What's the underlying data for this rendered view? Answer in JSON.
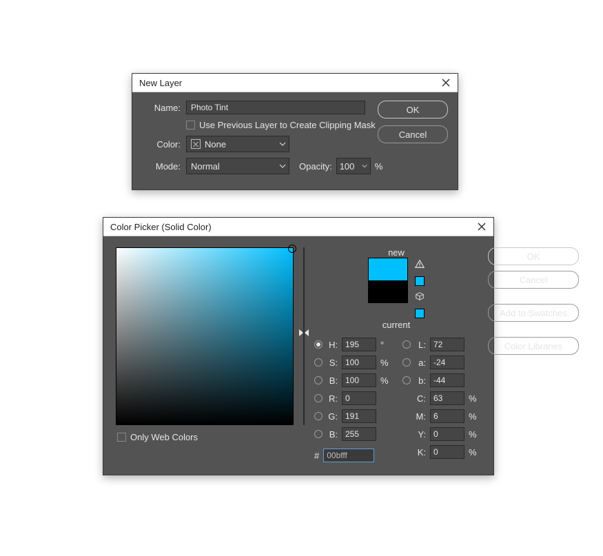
{
  "newLayer": {
    "title": "New Layer",
    "labels": {
      "name": "Name:",
      "color": "Color:",
      "mode": "Mode:",
      "opacity": "Opacity:",
      "pct": "%"
    },
    "nameValue": "Photo Tint",
    "usePrevious": "Use Previous Layer to Create Clipping Mask",
    "colorNone": "None",
    "modeValue": "Normal",
    "opacityValue": "100",
    "buttons": {
      "ok": "OK",
      "cancel": "Cancel"
    }
  },
  "colorPicker": {
    "title": "Color Picker (Solid Color)",
    "labels": {
      "new": "new",
      "current": "current",
      "onlyWeb": "Only Web Colors",
      "hash": "#"
    },
    "buttons": {
      "ok": "OK",
      "cancel": "Cancel",
      "addSwatch": "Add to Swatches",
      "colorLib": "Color Libraries"
    },
    "newColor": "#00bfff",
    "currentColor": "#000000",
    "hex": "00bfff",
    "H": {
      "lbl": "H:",
      "val": "195",
      "unit": "°"
    },
    "S": {
      "lbl": "S:",
      "val": "100",
      "unit": "%"
    },
    "Bhsb": {
      "lbl": "B:",
      "val": "100",
      "unit": "%"
    },
    "R": {
      "lbl": "R:",
      "val": "0"
    },
    "G": {
      "lbl": "G:",
      "val": "191"
    },
    "Brgb": {
      "lbl": "B:",
      "val": "255"
    },
    "L": {
      "lbl": "L:",
      "val": "72"
    },
    "a": {
      "lbl": "a:",
      "val": "-24"
    },
    "blab": {
      "lbl": "b:",
      "val": "-44"
    },
    "C": {
      "lbl": "C:",
      "val": "63",
      "unit": "%"
    },
    "M": {
      "lbl": "M:",
      "val": "6",
      "unit": "%"
    },
    "Y": {
      "lbl": "Y:",
      "val": "0",
      "unit": "%"
    },
    "K": {
      "lbl": "K:",
      "val": "0",
      "unit": "%"
    }
  }
}
